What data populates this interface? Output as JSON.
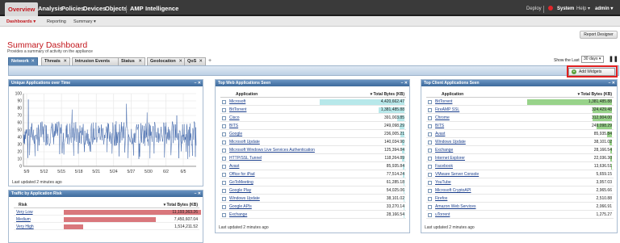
{
  "nav": {
    "items": [
      "Overview",
      "Analysis",
      "Policies",
      "Devices",
      "Objects",
      "AMP",
      "Intelligence"
    ],
    "deploy": "Deploy",
    "system": "System",
    "help": "Help ▾",
    "user": "admin ▾"
  },
  "subnav": {
    "items": [
      "Dashboards ▾",
      "Reporting",
      "Summary ▾"
    ]
  },
  "page": {
    "title": "Summary Dashboard",
    "subtitle": "Provides a summary of activity on the appliance",
    "report_designer": "Report Designer"
  },
  "tabs": [
    "Network",
    "Threats",
    "Intrusion Events",
    "Status",
    "Geolocation",
    "QoS"
  ],
  "tab_add": "+",
  "show_last_label": "Show the Last",
  "show_last_value": "30 days ▾",
  "add_widgets": "Add Widgets",
  "colors": {
    "brand_red": "#c2161c",
    "web_bar": "#b7e8ea",
    "client_bar": "#98d38a",
    "risk_bar": "#d9777c"
  },
  "unique_apps": {
    "title": "Unique Applications over Time",
    "footer": "Last updated 2 minutes ago",
    "chart_data": {
      "type": "line",
      "y_ticks": [
        "0",
        "10",
        "20",
        "30",
        "40",
        "50",
        "60",
        "70",
        "80",
        "90",
        "100"
      ],
      "x_ticks": [
        "5/9",
        "5/12",
        "5/15",
        "5/18",
        "5/21",
        "5/24",
        "5/27",
        "5/30",
        "6/2",
        "6/5"
      ],
      "ylim": [
        0,
        100
      ]
    }
  },
  "traffic_risk": {
    "title": "Traffic by Application Risk",
    "col_risk": "Risk",
    "col_bytes": "▾ Total Bytes (KB)",
    "rows": [
      {
        "label": "Very Low",
        "value": "11,193,363.26",
        "frac": 1.0
      },
      {
        "label": "Medium",
        "value": "7,450,607.04",
        "frac": 0.67
      },
      {
        "label": "Very High",
        "value": "1,514,211.52",
        "frac": 0.14
      }
    ]
  },
  "top_web": {
    "title": "Top Web Applications Seen",
    "col_app": "Application",
    "col_bytes": "▾ Total Bytes (KB)",
    "footer": "Last updated 2 minutes ago",
    "rows": [
      {
        "label": "Microsoft",
        "value": "4,420,662.47",
        "frac": 1.0
      },
      {
        "label": "BitTorrent",
        "value": "1,381,485.88",
        "frac": 0.31
      },
      {
        "label": "Cisco",
        "value": "391,003.85",
        "frac": 0.09
      },
      {
        "label": "BITS",
        "value": "249,098.29",
        "frac": 0.06
      },
      {
        "label": "Google",
        "value": "236,005.21",
        "frac": 0.05
      },
      {
        "label": "Microsoft Update",
        "value": "140,034.90",
        "frac": 0.03
      },
      {
        "label": "Microsoft Windows Live Services Authentication",
        "value": "125,394.84",
        "frac": 0.03
      },
      {
        "label": "HTTP/SSL Tunnel",
        "value": "118,264.89",
        "frac": 0.03
      },
      {
        "label": "Avast",
        "value": "85,935.84",
        "frac": 0.02
      },
      {
        "label": "Office for iPad",
        "value": "77,514.24",
        "frac": 0.02
      },
      {
        "label": "GoToMeeting",
        "value": "61,285.18",
        "frac": 0.01
      },
      {
        "label": "Google Play",
        "value": "54,025.06",
        "frac": 0.01
      },
      {
        "label": "Windows Update",
        "value": "38,101.02",
        "frac": 0.01
      },
      {
        "label": "Google APIs",
        "value": "33,270.14",
        "frac": 0.01
      },
      {
        "label": "Exchange",
        "value": "28,166.54",
        "frac": 0.01
      }
    ]
  },
  "top_client": {
    "title": "Top Client Applications Seen",
    "col_app": "Application",
    "col_bytes": "▾ Total Bytes (KB)",
    "footer": "Last updated 2 minutes ago",
    "rows": [
      {
        "label": "BitTorrent",
        "value": "1,381,485.88",
        "frac": 1.0
      },
      {
        "label": "FireAMP SSL",
        "value": "324,429.48",
        "frac": 0.23
      },
      {
        "label": "Chrome",
        "value": "312,904.00",
        "frac": 0.23
      },
      {
        "label": "BITS",
        "value": "249,098.29",
        "frac": 0.18
      },
      {
        "label": "Avast",
        "value": "85,935.84",
        "frac": 0.06
      },
      {
        "label": "Windows Update",
        "value": "38,101.02",
        "frac": 0.03
      },
      {
        "label": "Exchange",
        "value": "28,166.54",
        "frac": 0.02
      },
      {
        "label": "Internet Explorer",
        "value": "22,036.30",
        "frac": 0.02
      },
      {
        "label": "Facebook",
        "value": "13,636.51",
        "frac": 0.01
      },
      {
        "label": "VMware Server Console",
        "value": "5,659.15",
        "frac": 0.0
      },
      {
        "label": "YouTube",
        "value": "3,957.03",
        "frac": 0.0
      },
      {
        "label": "Microsoft CryptoAPI",
        "value": "2,965.66",
        "frac": 0.0
      },
      {
        "label": "Firefox",
        "value": "2,510.88",
        "frac": 0.0
      },
      {
        "label": "Amazon Web Services",
        "value": "2,066.91",
        "frac": 0.0
      },
      {
        "label": "uTorrent",
        "value": "1,275.27",
        "frac": 0.0
      }
    ]
  }
}
